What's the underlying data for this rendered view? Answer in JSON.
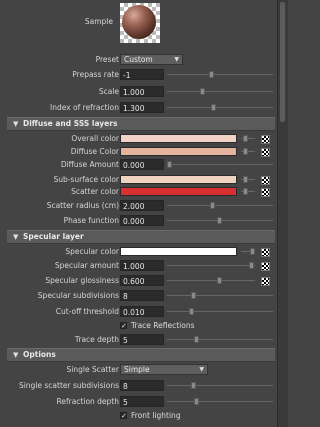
{
  "sample": {
    "label": "Sample"
  },
  "top": {
    "preset": {
      "label": "Preset",
      "value": "Custom"
    },
    "prepass_rate": {
      "label": "Prepass rate",
      "value": "-1"
    },
    "scale": {
      "label": "Scale",
      "value": "1.000"
    },
    "ior": {
      "label": "Index of refraction",
      "value": "1.300"
    }
  },
  "diffuse_section": {
    "title": "Diffuse and SSS layers",
    "overall_color": {
      "label": "Overall color",
      "color": "#f2d2c6"
    },
    "diffuse_color": {
      "label": "Diffuse Color",
      "color": "#e6b39e"
    },
    "diffuse_amount": {
      "label": "Diffuse Amount",
      "value": "0.000"
    },
    "subsurface_color": {
      "label": "Sub-surface color",
      "color": "#efd3bf"
    },
    "scatter_color": {
      "label": "Scatter color",
      "color": "#d83030"
    },
    "scatter_radius": {
      "label": "Scatter radius (cm)",
      "value": "2.000"
    },
    "phase_function": {
      "label": "Phase function",
      "value": "0.000"
    }
  },
  "specular_section": {
    "title": "Specular layer",
    "specular_color": {
      "label": "Specular color",
      "color": "#ffffff"
    },
    "specular_amount": {
      "label": "Specular amount",
      "value": "1.000"
    },
    "specular_glossiness": {
      "label": "Specular glossiness",
      "value": "0.600"
    },
    "specular_subdivisions": {
      "label": "Specular subdivisions",
      "value": "8"
    },
    "cutoff_threshold": {
      "label": "Cut-off threshold",
      "value": "0.010"
    },
    "trace_reflections": {
      "label": "Trace Reflections",
      "checked": true
    },
    "trace_depth": {
      "label": "Trace depth",
      "value": "5"
    }
  },
  "options_section": {
    "title": "Options",
    "single_scatter": {
      "label": "Single Scatter",
      "value": "Simple"
    },
    "single_scatter_subdivisions": {
      "label": "Single scatter subdivisions",
      "value": "8"
    },
    "refraction_depth": {
      "label": "Refraction depth",
      "value": "5"
    },
    "front_lighting": {
      "label": "Front lighting",
      "checked": true
    }
  },
  "icons": {
    "collapse": "triangle-down-icon",
    "checker": "checker-map-icon"
  }
}
